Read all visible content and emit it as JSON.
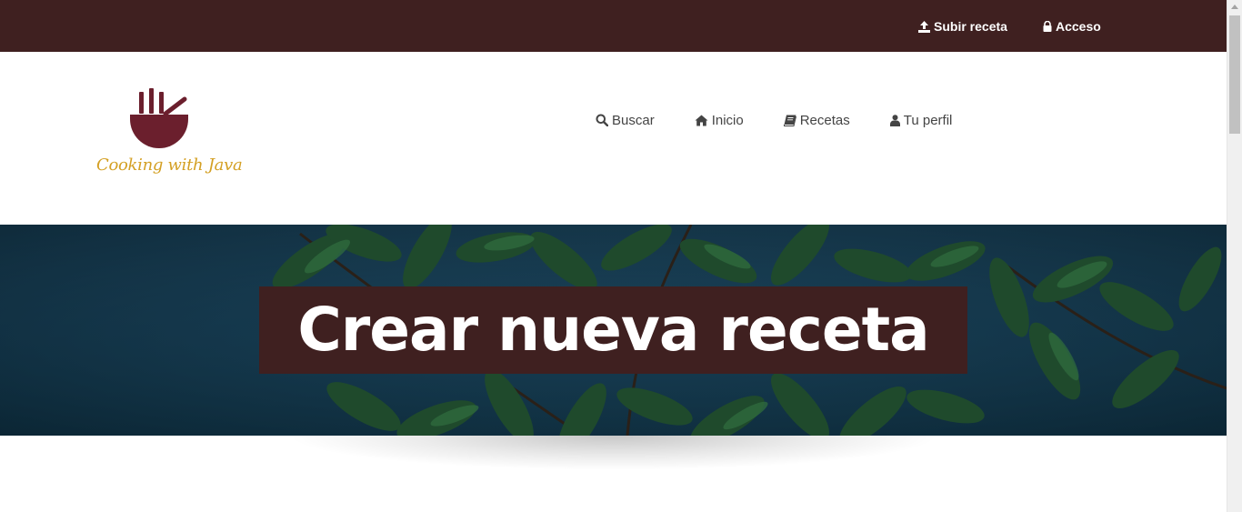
{
  "topbar": {
    "upload_label": "Subir receta",
    "upload_icon": "upload-icon",
    "login_label": "Acceso",
    "login_icon": "lock-icon",
    "background": "#3f2020"
  },
  "logo": {
    "text": "Cooking with Java",
    "mark_color": "#6b1f2d",
    "text_color": "#d4a024"
  },
  "nav": {
    "items": [
      {
        "label": "Buscar",
        "icon": "search-icon"
      },
      {
        "label": "Inicio",
        "icon": "home-icon"
      },
      {
        "label": "Recetas",
        "icon": "book-icon"
      },
      {
        "label": "Tu perfil",
        "icon": "user-icon"
      }
    ]
  },
  "hero": {
    "title": "Crear nueva receta",
    "box_color": "#3f2020"
  }
}
